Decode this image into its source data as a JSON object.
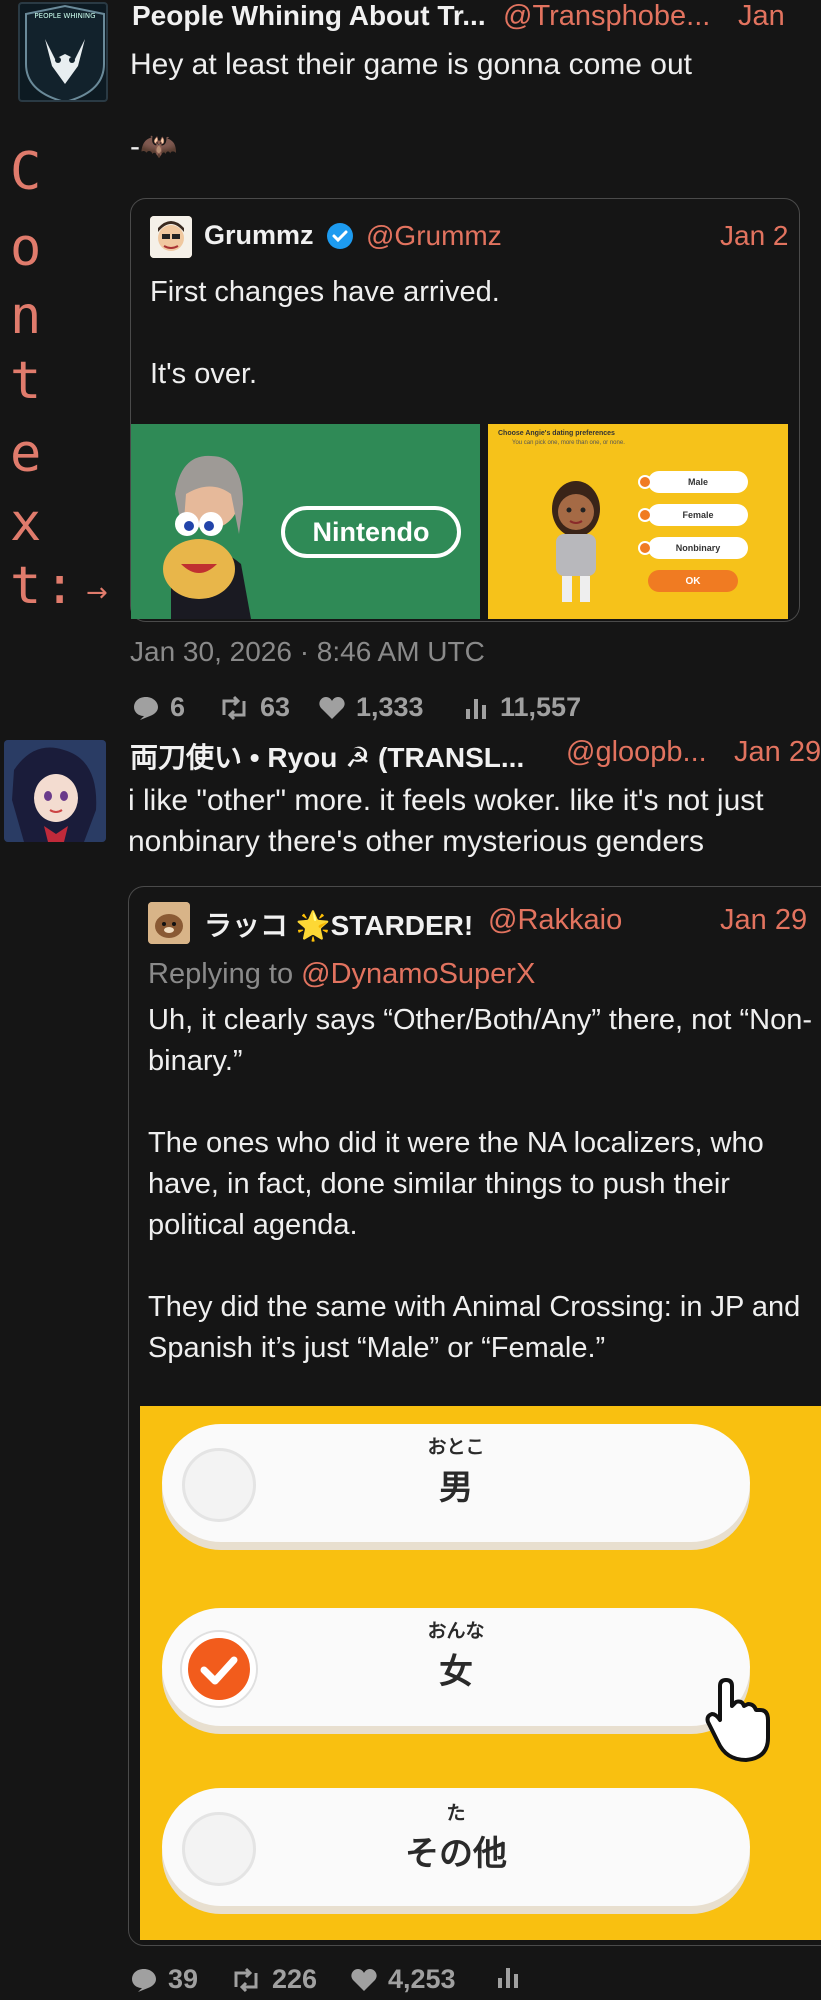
{
  "context_label": [
    "C",
    "o",
    "n",
    "t",
    "e",
    "x",
    "t",
    ":"
  ],
  "context_arrow": "→",
  "post1": {
    "name": "People Whining About Tr...",
    "handle": "@Transphobe...",
    "date_short": "Jan",
    "text": "Hey at least their game is gonna come out\n\n-🦇",
    "avatar_text": "PEOPLE WHINING",
    "quote": {
      "name": "Grummz",
      "handle": "@Grummz",
      "date_short": "Jan 2",
      "text": "First changes have arrived.\n\nIt's over.",
      "image_left_logo": "Nintendo",
      "image_right": {
        "title": "Choose Angie's dating preferences",
        "subtitle": "You can pick one, more than one, or none.",
        "options": [
          "Male",
          "Female",
          "Nonbinary"
        ],
        "ok_label": "OK"
      }
    },
    "timestamp": "Jan 30, 2026 · 8:46 AM UTC",
    "stats": {
      "replies": "6",
      "retweets": "63",
      "likes": "1,333",
      "views": "11,557"
    }
  },
  "post2": {
    "name": "両刀使い • Ryou ☭ (TRANSL...",
    "handle": "@gloopb...",
    "date_short": "Jan 29",
    "text": "i like \"other\" more. it feels woker. like it's not just nonbinary there's other mysterious genders",
    "quote": {
      "name": "ラッコ 🌟STARDER!",
      "handle": "@Rakkaio",
      "date_short": "Jan 29",
      "reply_prefix": "Replying to ",
      "reply_to": "@DynamoSuperX",
      "text": "Uh, it clearly says “Other/Both/Any” there, not “Non-binary.”\n\nThe ones who did it were the NA localizers, who have, in fact, done similar things to push their political agenda.\n\nThey did the same with Animal Crossing: in JP and Spanish it’s just “Male” or “Female.”",
      "options": [
        {
          "furigana": "おとこ",
          "kanji": "男",
          "selected": false
        },
        {
          "furigana": "おんな",
          "kanji": "女",
          "selected": true
        },
        {
          "furigana": "た",
          "kanji": "その他",
          "selected": false
        }
      ]
    },
    "stats": {
      "replies": "39",
      "retweets": "226",
      "likes": "4,253"
    }
  },
  "colors": {
    "handle": "#e2735f",
    "context": "#e07b6c",
    "background": "#151515",
    "accent_yellow": "#f9c010",
    "verified": "#1d9bf0"
  }
}
